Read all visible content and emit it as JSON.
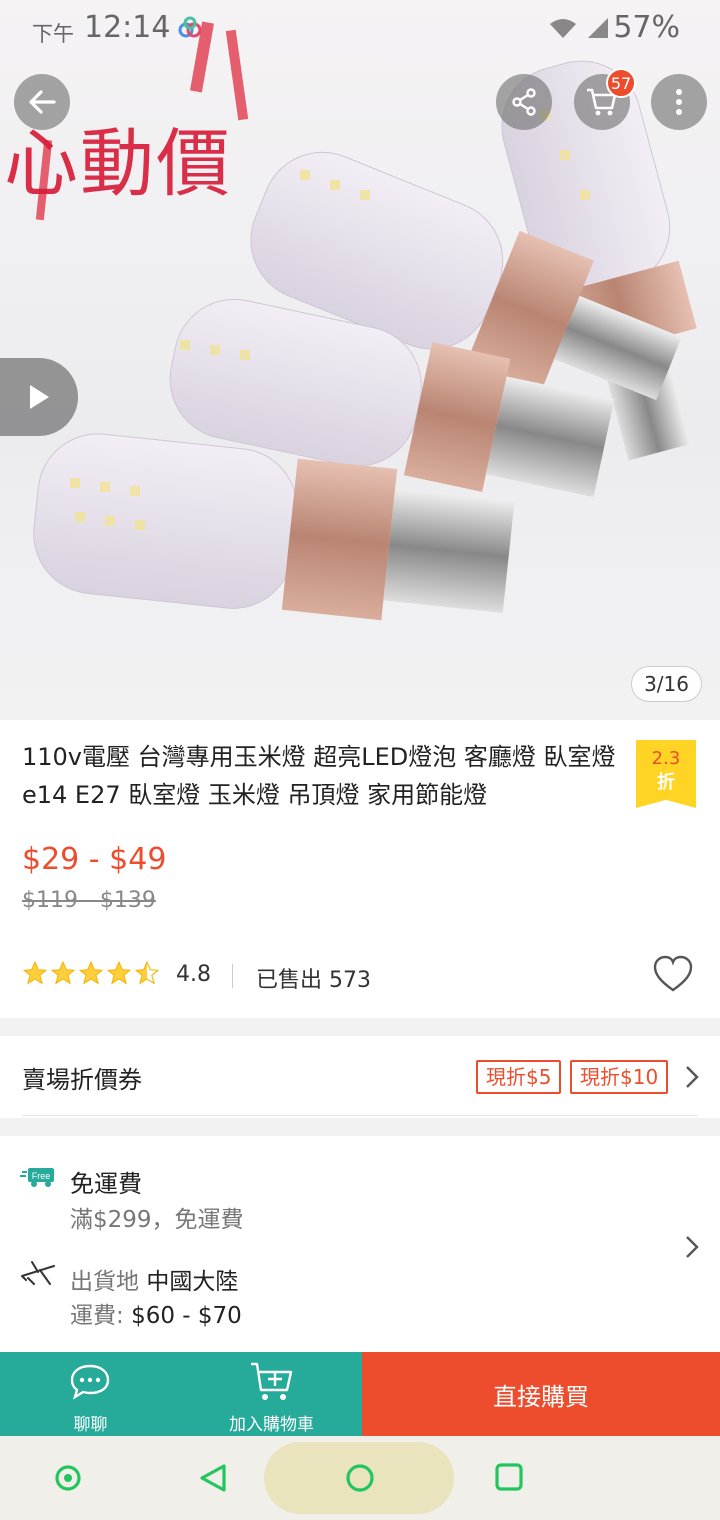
{
  "status_bar": {
    "time_prefix": "下午",
    "time": "12:14",
    "battery": "57%"
  },
  "hero": {
    "promo_text": "心動價",
    "cart_count": "57",
    "image_index": "3/16"
  },
  "product": {
    "title": "110v電壓 台灣專用玉米燈 超亮LED燈泡 客廳燈 臥室燈e14 E27 臥室燈 玉米燈 吊頂燈 家用節能燈",
    "discount_value": "2.3",
    "discount_unit": "折",
    "price": "$29 - $49",
    "original_price": "$119 - $139",
    "rating_value": 4.8,
    "rating": "4.8",
    "sold": "已售出 573"
  },
  "coupons": {
    "label": "賣場折價券",
    "tags": [
      "現折$5",
      "現折$10"
    ]
  },
  "shipping": {
    "free_title": "免運費",
    "free_sub": "滿$299，免運費",
    "from_label": "出貨地",
    "from_value": "中國大陸",
    "fee_label": "運費:",
    "fee_value": "$60 - $70",
    "free_icon_text": "Free"
  },
  "bottom_bar": {
    "chat": "聊聊",
    "add_cart": "加入購物車",
    "buy_now": "直接購買"
  },
  "colors": {
    "accent": "#ee4d2d",
    "teal": "#26aa99",
    "badge": "#ffd424"
  }
}
